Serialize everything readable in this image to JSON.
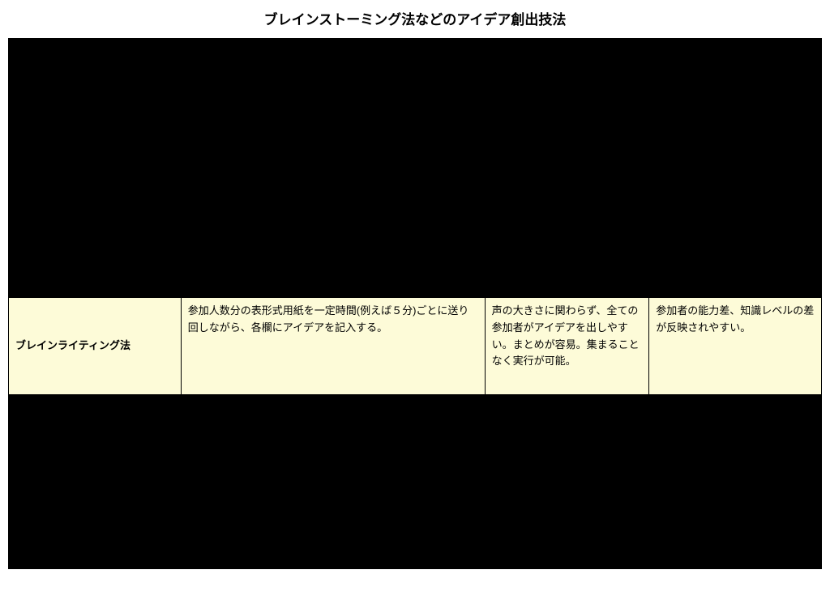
{
  "title": "ブレインストーミング法などのアイデア創出技法",
  "highlighted_row": {
    "method": "ブレインライティング法",
    "description": "参加人数分の表形式用紙を一定時間(例えば５分)ごとに送り回しながら、各欄にアイデアを記入する。",
    "advantage": "声の大きさに関わらず、全ての参加者がアイデアを出しやすい。まとめが容易。集まることなく実行が可能。",
    "disadvantage": "参加者の能力差、知識レベルの差が反映されやすい。"
  }
}
